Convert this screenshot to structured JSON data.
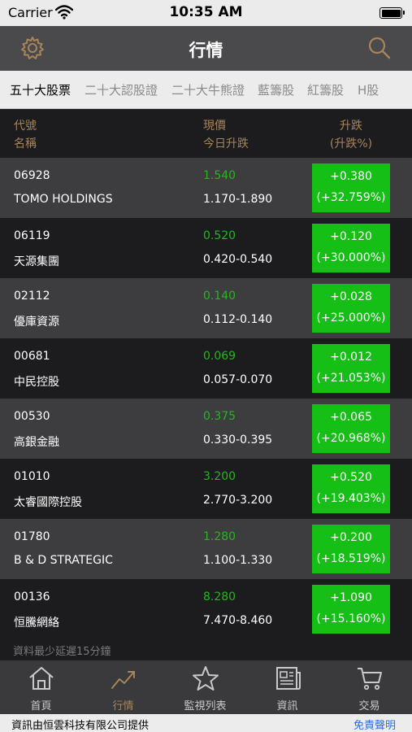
{
  "status_bar": {
    "carrier": "Carrier",
    "time": "10:35 AM"
  },
  "nav": {
    "title": "行情"
  },
  "tabs": [
    {
      "label": "五十大股票",
      "active": true
    },
    {
      "label": "二十大認股證",
      "active": false
    },
    {
      "label": "二十大牛熊證",
      "active": false
    },
    {
      "label": "藍籌股",
      "active": false
    },
    {
      "label": "紅籌股",
      "active": false
    },
    {
      "label": "H股",
      "active": false
    }
  ],
  "columns": {
    "code": "代號",
    "name": "名稱",
    "price": "現價",
    "range": "今日升跌",
    "change": "升跌",
    "change_pct": "(升跌%)"
  },
  "stocks": [
    {
      "code": "06928",
      "name": "TOMO HOLDINGS",
      "price": "1.540",
      "range": "1.170-1.890",
      "change": "+0.380",
      "change_pct": "(+32.759%)"
    },
    {
      "code": "06119",
      "name": "天源集團",
      "price": "0.520",
      "range": "0.420-0.540",
      "change": "+0.120",
      "change_pct": "(+30.000%)"
    },
    {
      "code": "02112",
      "name": "優庫資源",
      "price": "0.140",
      "range": "0.112-0.140",
      "change": "+0.028",
      "change_pct": "(+25.000%)"
    },
    {
      "code": "00681",
      "name": "中民控股",
      "price": "0.069",
      "range": "0.057-0.070",
      "change": "+0.012",
      "change_pct": "(+21.053%)"
    },
    {
      "code": "00530",
      "name": "高銀金融",
      "price": "0.375",
      "range": "0.330-0.395",
      "change": "+0.065",
      "change_pct": "(+20.968%)"
    },
    {
      "code": "01010",
      "name": "太睿國際控股",
      "price": "3.200",
      "range": "2.770-3.200",
      "change": "+0.520",
      "change_pct": "(+19.403%)"
    },
    {
      "code": "01780",
      "name": "B & D STRATEGIC",
      "price": "1.280",
      "range": "1.100-1.330",
      "change": "+0.200",
      "change_pct": "(+18.519%)"
    },
    {
      "code": "00136",
      "name": "恒騰網絡",
      "price": "8.280",
      "range": "7.470-8.460",
      "change": "+1.090",
      "change_pct": "(+15.160%)"
    }
  ],
  "delay_note": "資料最少延遲15分鐘",
  "tabbar": [
    {
      "label": "首頁",
      "icon": "home-icon",
      "active": false
    },
    {
      "label": "行情",
      "icon": "trend-icon",
      "active": true
    },
    {
      "label": "監視列表",
      "icon": "star-icon",
      "active": false
    },
    {
      "label": "資訊",
      "icon": "newspaper-icon",
      "active": false
    },
    {
      "label": "交易",
      "icon": "cart-icon",
      "active": false
    }
  ],
  "footer": {
    "provider": "資訊由恒雲科技有限公司提供",
    "disclaimer": "免責聲明"
  },
  "colors": {
    "accent": "#a7855a",
    "up_green": "#16bf16",
    "price_green": "#27b41f",
    "nav_bg": "#4a4a4c",
    "row_light": "#3d3d3f",
    "row_dark": "#1c1c1e",
    "link_blue": "#2a6ee0"
  }
}
